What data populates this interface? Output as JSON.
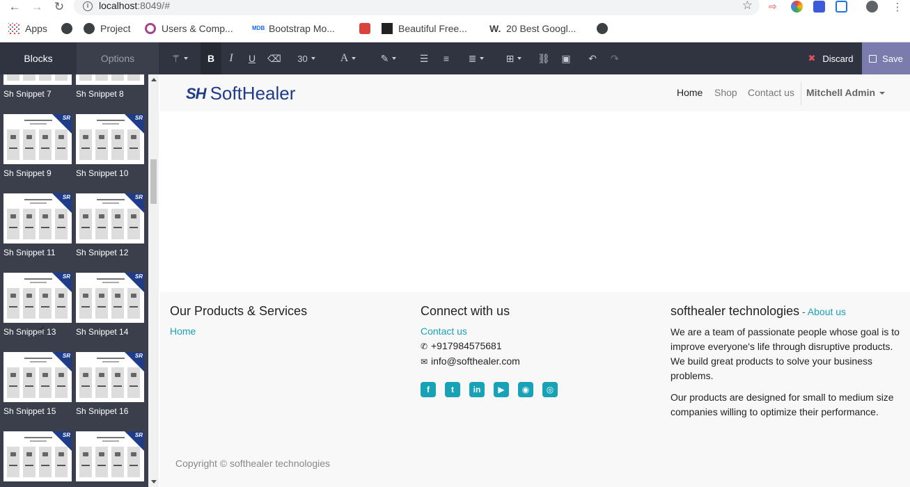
{
  "browser": {
    "url_host": "localhost",
    "url_rest": ":8049/#",
    "bookmarks": [
      {
        "label": "Apps",
        "icon": "apps-grid-icon"
      },
      {
        "label": "",
        "icon": "globe-icon"
      },
      {
        "label": "Project",
        "icon": "globe-icon"
      },
      {
        "label": "Users & Comp...",
        "icon": "odoo-icon"
      },
      {
        "label": "Bootstrap Mo...",
        "icon": "mdb-icon"
      },
      {
        "label": "",
        "icon": "bootstrap-icon"
      },
      {
        "label": "Beautiful Free...",
        "icon": "building-icon"
      },
      {
        "label": "20 Best Googl...",
        "icon": "w-icon"
      },
      {
        "label": "",
        "icon": "globe-icon"
      }
    ]
  },
  "sidebar": {
    "tabs": [
      "Blocks",
      "Options"
    ],
    "snippets": [
      {
        "label": "Sh Snippet 7"
      },
      {
        "label": "Sh Snippet 8"
      },
      {
        "label": "Sh Snippet 9"
      },
      {
        "label": "Sh Snippet 10"
      },
      {
        "label": "Sh Snippet 11"
      },
      {
        "label": "Sh Snippet 12"
      },
      {
        "label": "Sh Snippet 13"
      },
      {
        "label": "Sh Snippet 14"
      },
      {
        "label": "Sh Snippet 15"
      },
      {
        "label": "Sh Snippet 16"
      },
      {
        "label": ""
      },
      {
        "label": ""
      }
    ]
  },
  "toolbar": {
    "font_size": "30",
    "discard_label": "Discard",
    "save_label": "Save"
  },
  "site": {
    "logo_mark": "SH",
    "logo_text": "SoftHealer",
    "nav": [
      "Home",
      "Shop",
      "Contact us"
    ],
    "user": "Mitchell Admin"
  },
  "footer": {
    "col1_title": "Our Products & Services",
    "col1_link": "Home",
    "col2_title": "Connect with us",
    "col2_link": "Contact us",
    "phone": "+917984575681",
    "email": "info@softhealer.com",
    "col3_title": "softhealer technologies",
    "col3_sep": " - ",
    "col3_link": "About us",
    "para1": "We are a team of passionate people whose goal is to improve everyone's life through disruptive products. We build great products to solve your business problems.",
    "para2": "Our products are designed for small to medium size companies willing to optimize their performance.",
    "copyright": "Copyright © softhealer technologies",
    "social": [
      {
        "icon": "facebook-icon",
        "glyph": "f"
      },
      {
        "icon": "twitter-icon",
        "glyph": "t"
      },
      {
        "icon": "linkedin-icon",
        "glyph": "in"
      },
      {
        "icon": "youtube-icon",
        "glyph": "▶"
      },
      {
        "icon": "github-icon",
        "glyph": "◉"
      },
      {
        "icon": "instagram-icon",
        "glyph": "◎"
      }
    ]
  }
}
